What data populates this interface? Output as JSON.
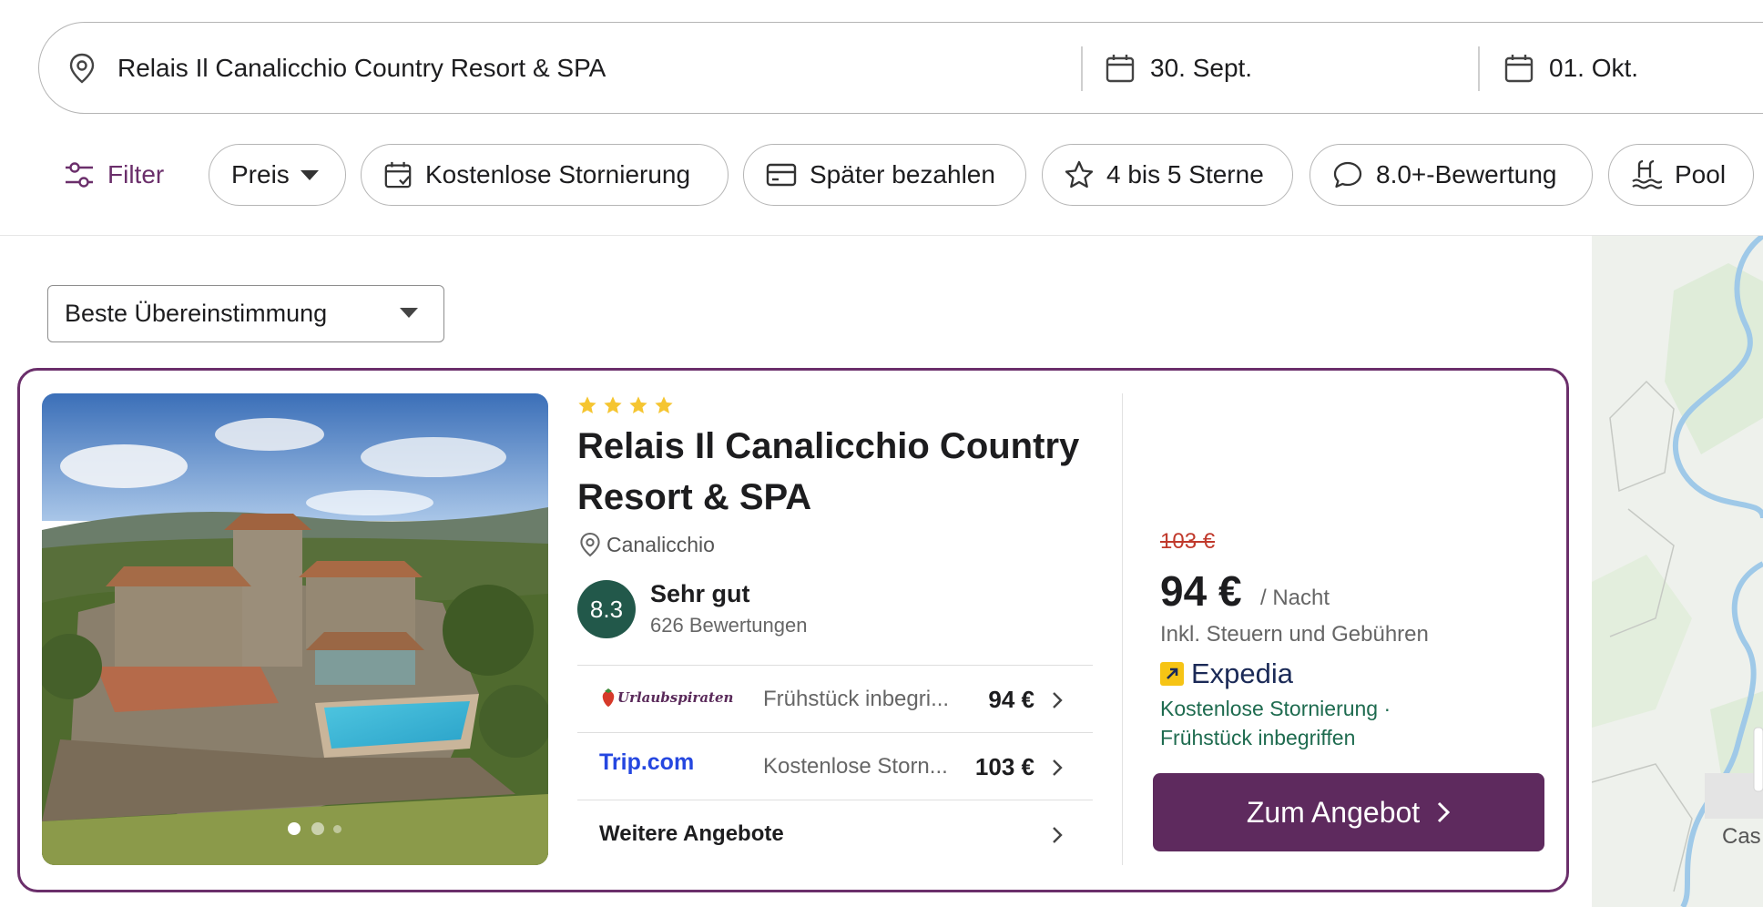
{
  "search": {
    "destination": "Relais Il Canalicchio Country Resort & SPA",
    "checkin": "30. Sept.",
    "checkout": "01. Okt."
  },
  "filters": {
    "filter_label": "Filter",
    "chips": [
      "Preis",
      "Kostenlose Stornierung",
      "Später bezahlen",
      "4 bis 5 Sterne",
      "8.0+-Bewertung",
      "Pool"
    ]
  },
  "sort": {
    "selected": "Beste Übereinstimmung"
  },
  "hotel": {
    "stars": 4,
    "name": "Relais Il Canalicchio Country Resort & SPA",
    "location": "Canalicchio",
    "score": "8.3",
    "rating_word": "Sehr gut",
    "reviews": "626 Bewertungen",
    "image_slides": 3,
    "offers": [
      {
        "provider": "Urlaubspiraten",
        "description": "Frühstück inbegri...",
        "price": "94 €"
      },
      {
        "provider": "Trip.com",
        "description": "Kostenlose Storn...",
        "price": "103 €"
      }
    ],
    "more_offers": "Weitere Angebote",
    "old_price": "103 €",
    "price": "94 €",
    "per_night": "/ Nacht",
    "price_note": "Inkl. Steuern und Gebühren",
    "deal_provider": "Expedia",
    "benefits_line1": "Kostenlose Stornierung ·",
    "benefits_line2": "Frühstück inbegriffen",
    "cta": "Zum Angebot"
  },
  "map": {
    "label": "Cas"
  },
  "colors": {
    "accent": "#6b2f6b",
    "cta": "#5e2a5e",
    "score": "#22584a",
    "benefit": "#1e6b4f",
    "old_price": "#c0392b",
    "star": "#f5c531"
  }
}
